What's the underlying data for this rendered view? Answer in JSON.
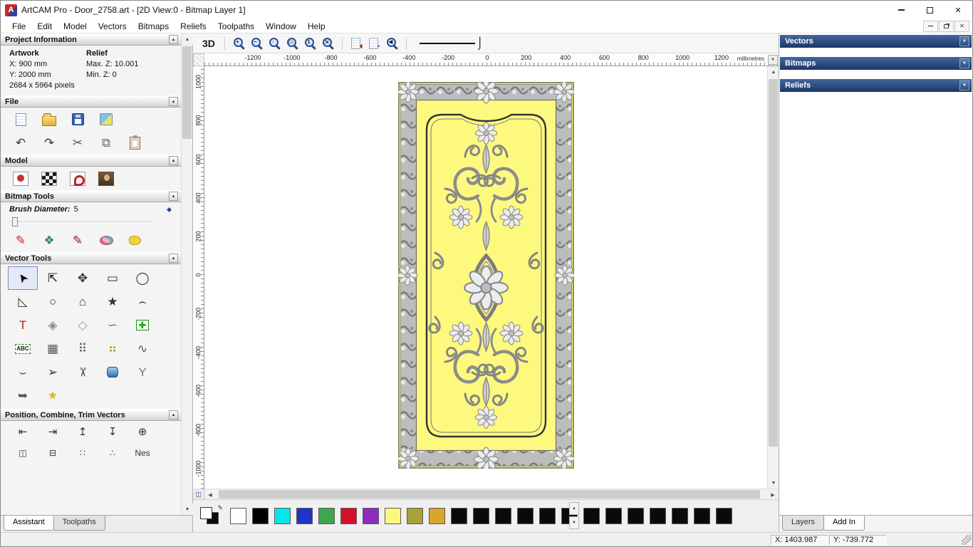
{
  "window": {
    "title": "ArtCAM Pro - Door_2758.art - [2D View:0 - Bitmap Layer 1]"
  },
  "menu": {
    "items": [
      {
        "name": "menu-file",
        "label": "File"
      },
      {
        "name": "menu-edit",
        "label": "Edit"
      },
      {
        "name": "menu-model",
        "label": "Model"
      },
      {
        "name": "menu-vectors",
        "label": "Vectors"
      },
      {
        "name": "menu-bitmaps",
        "label": "Bitmaps"
      },
      {
        "name": "menu-reliefs",
        "label": "Reliefs"
      },
      {
        "name": "menu-toolpaths",
        "label": "Toolpaths"
      },
      {
        "name": "menu-window",
        "label": "Window"
      },
      {
        "name": "menu-help",
        "label": "Help"
      }
    ]
  },
  "assistant": {
    "sections": {
      "project_information": "Project Information",
      "file": "File",
      "model": "Model",
      "bitmap_tools": "Bitmap Tools",
      "vector_tools": "Vector Tools",
      "position_combine": "Position, Combine, Trim Vectors"
    },
    "project_info": {
      "artwork_label": "Artwork",
      "relief_label": "Relief",
      "x": "X: 900 mm",
      "y": "Y: 2000 mm",
      "pixels": "2684 x 5964 pixels",
      "max_z": "Max. Z: 10.001",
      "min_z": "Min. Z: 0"
    },
    "file_icons_row1": [
      {
        "name": "new-model-icon",
        "css": "ic-page"
      },
      {
        "name": "open-model-icon",
        "css": "ic-folder"
      },
      {
        "name": "save-model-icon",
        "css": "ic-floppy"
      },
      {
        "name": "import-model-icon",
        "css": "ic-export"
      }
    ],
    "file_icons_row2": [
      {
        "name": "undo-icon",
        "glyph": "↶",
        "color": "#3a3a3a"
      },
      {
        "name": "redo-icon",
        "glyph": "↷",
        "color": "#3a3a3a"
      },
      {
        "name": "cut-icon",
        "glyph": "✂",
        "color": "#555555"
      },
      {
        "name": "copy-icon",
        "glyph": "⧉",
        "color": "#6a6a6a"
      },
      {
        "name": "paste-icon",
        "css": "ic-clipboard"
      }
    ],
    "model_icons": [
      {
        "name": "adjust-model-icon",
        "css": "ic-model1"
      },
      {
        "name": "greyscale-view-icon",
        "css": "ic-model2"
      },
      {
        "name": "sculpt-relief-icon",
        "css": "ic-model3"
      },
      {
        "name": "load-image-icon",
        "css": "ic-model4"
      }
    ],
    "bitmap_tools": {
      "brush_label": "Brush Diameter:",
      "brush_value": "5"
    },
    "paint_icons": [
      {
        "name": "paint-icon",
        "glyph": "✎",
        "color": "#cc2222"
      },
      {
        "name": "paint-selective-icon",
        "glyph": "❖",
        "color": "#2e8b57"
      },
      {
        "name": "draw-icon",
        "glyph": "✎",
        "color": "#8a2222"
      },
      {
        "name": "colour-palette-icon",
        "css": "ic-palette"
      },
      {
        "name": "flood-fill-icon",
        "css": "ic-blob"
      }
    ],
    "vector_icons": [
      {
        "name": "select-vectors-icon",
        "glyph": "➤",
        "css": "rot-ul",
        "color": "#101010",
        "active": true
      },
      {
        "name": "node-editing-icon",
        "glyph": "⇱",
        "color": "#101010"
      },
      {
        "name": "transform-vectors-icon",
        "glyph": "✥",
        "color": "#333333"
      },
      {
        "name": "create-rectangle-icon",
        "glyph": "▭",
        "color": "#333333"
      },
      {
        "name": "create-ellipse-icon",
        "glyph": "◯",
        "color": "#333333"
      },
      {
        "name": "create-freehand-icon",
        "glyph": "◺",
        "color": "#333333"
      },
      {
        "name": "create-circle-icon",
        "glyph": "○",
        "color": "#333333"
      },
      {
        "name": "create-polygon-icon",
        "glyph": "⌂",
        "color": "#333333"
      },
      {
        "name": "create-star-icon",
        "glyph": "★",
        "color": "#333333"
      },
      {
        "name": "create-arc-icon",
        "glyph": "⌢",
        "color": "#333333"
      },
      {
        "name": "create-text-icon",
        "glyph": "T",
        "color": "#b22222"
      },
      {
        "name": "wrap-text-icon",
        "glyph": "◈",
        "color": "#8a8a8a"
      },
      {
        "name": "measure-icon",
        "glyph": "◇",
        "color": "#9a9a9a"
      },
      {
        "name": "text-on-curve-icon",
        "glyph": "∽",
        "color": "#c06010"
      },
      {
        "name": "paste-vector-icon",
        "glyph": "✚",
        "color": "#1f9e1f",
        "css": "boxed-green"
      },
      {
        "name": "text-block-icon",
        "glyph": "ABC",
        "css": "abc"
      },
      {
        "name": "snap-grid-icon",
        "glyph": "▦",
        "color": "#555555"
      },
      {
        "name": "block-copy-icon",
        "glyph": "⠿",
        "color": "#555555"
      },
      {
        "name": "paste-along-curve-icon",
        "glyph": "⠶",
        "color": "#b8860b"
      },
      {
        "name": "fit-arcs-icon",
        "glyph": "∿",
        "color": "#555555"
      },
      {
        "name": "create-polyline-icon",
        "glyph": "⌣",
        "color": "#555555"
      },
      {
        "name": "join-vectors-icon",
        "glyph": "➢",
        "color": "#333333"
      },
      {
        "name": "trim-vectors-icon",
        "glyph": "✂",
        "css": "rot-45",
        "color": "#333333"
      },
      {
        "name": "interpolate-icon",
        "css": "ic-spool"
      },
      {
        "name": "fit-spline-icon",
        "glyph": "Y",
        "color": "#777777"
      },
      {
        "name": "mirror-vectors-icon",
        "glyph": "➥",
        "color": "#555555"
      },
      {
        "name": "wrap-star-icon",
        "glyph": "★",
        "color": "#e8b820",
        "css": "small-star"
      }
    ],
    "position_icons_row1": [
      {
        "name": "align-left-icon",
        "glyph": "⇤"
      },
      {
        "name": "align-right-icon",
        "glyph": "⇥"
      },
      {
        "name": "align-top-icon",
        "glyph": "↥"
      },
      {
        "name": "align-bottom-icon",
        "glyph": "↧"
      },
      {
        "name": "align-centre-icon",
        "glyph": "⊕"
      }
    ],
    "position_icons_row2": [
      {
        "name": "combine-vectors-icon",
        "glyph": "◫"
      },
      {
        "name": "subtract-vectors-icon",
        "glyph": "⊟"
      },
      {
        "name": "scatter-copies-icon",
        "glyph": "∷"
      },
      {
        "name": "array-copy-icon",
        "glyph": "∴"
      },
      {
        "name": "nesting-icon",
        "glyph": "Nes"
      }
    ],
    "tabs": [
      {
        "name": "tab-assistant",
        "label": "Assistant",
        "active": true
      },
      {
        "name": "tab-toolpaths",
        "label": "Toolpaths",
        "active": false
      }
    ]
  },
  "canvas": {
    "toolbar": {
      "view_3d": "3D",
      "zoom_tools": [
        {
          "name": "zoom-in-icon",
          "sub": "+"
        },
        {
          "name": "zoom-out-icon",
          "sub": "−"
        },
        {
          "name": "zoom-object-icon",
          "sub": "▫"
        },
        {
          "name": "zoom-box-icon",
          "sub": "▭"
        },
        {
          "name": "zoom-1to1-icon",
          "sub": "1"
        },
        {
          "name": "zoom-fit-icon",
          "sub": "⇲"
        }
      ],
      "layer_tools": [
        {
          "name": "previous-layer-icon",
          "sub": "◀",
          "color": "#b22222"
        },
        {
          "name": "next-layer-icon",
          "sub": "▶",
          "color": "#2233b2"
        }
      ],
      "view_back": [
        {
          "name": "previous-view-icon",
          "sub": "◀"
        }
      ]
    },
    "ruler": {
      "unit": "millimetres",
      "h_labels": [
        "-1200",
        "-1000",
        "-800",
        "-600",
        "-400",
        "-200",
        "0",
        "200",
        "400",
        "600",
        "800",
        "1000",
        "1200"
      ],
      "v_labels": [
        "1000",
        "800",
        "600",
        "400",
        "200",
        "0",
        "-200",
        "-400",
        "-600",
        "-800",
        "-1000"
      ]
    },
    "door": {
      "background": "#fcf97e",
      "ornament_base": "#bdbdbd",
      "ornament_dark": "#7a7a7a",
      "ornament_light": "#ececec",
      "frame": "#333333"
    }
  },
  "palette": {
    "colors": [
      "#ffffff",
      "#000000",
      "#00e8e8",
      "#2233c8",
      "#3fa64b",
      "#d6102a",
      "#8f2bbf",
      "#faf97e",
      "#a8a23b",
      "#d8a62a",
      "#0a0a0a",
      "#0a0a0a",
      "#0a0a0a",
      "#0a0a0a",
      "#0a0a0a",
      "#0a0a0a",
      "#0a0a0a",
      "#0a0a0a",
      "#0a0a0a",
      "#0a0a0a",
      "#0a0a0a",
      "#0a0a0a",
      "#0a0a0a"
    ]
  },
  "right_panel": {
    "headers": [
      {
        "name": "vectors-panel-header",
        "label": "Vectors"
      },
      {
        "name": "bitmaps-panel-header",
        "label": "Bitmaps"
      },
      {
        "name": "reliefs-panel-header",
        "label": "Reliefs"
      }
    ],
    "tabs": [
      {
        "name": "tab-layers",
        "label": "Layers",
        "active": false
      },
      {
        "name": "tab-add-in",
        "label": "Add In",
        "active": true
      }
    ]
  },
  "status": {
    "x": "X: 1403.987",
    "y": "Y: -739.772"
  }
}
